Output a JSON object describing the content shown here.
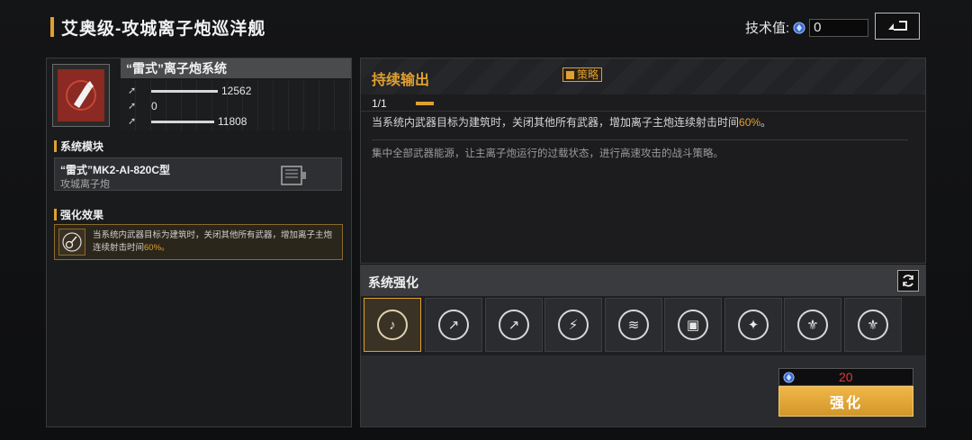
{
  "header": {
    "title": "艾奥级-攻城离子炮巡洋舰",
    "tech_label": "技术值:",
    "tech_value": "0"
  },
  "weapon": {
    "name": "“雷式”离子炮系统",
    "stats": [
      {
        "icon": "damage-icon",
        "value": "12562"
      },
      {
        "icon": "penetration-icon",
        "value": "0"
      },
      {
        "icon": "range-icon",
        "value": "11808"
      }
    ]
  },
  "module_section": {
    "label": "系统模块",
    "module_name": "“雷式”MK2-AI-820C型",
    "module_type": "攻城离子炮"
  },
  "effect_section": {
    "label": "强化效果",
    "text_main": "当系统内武器目标为建筑时，关闭其他所有武器，增加离子主炮连续射击时间",
    "text_highlight": "60%。"
  },
  "skill": {
    "title": "持续输出",
    "tag": "策略",
    "level": "1/1",
    "desc_main": "当系统内武器目标为建筑时，关闭其他所有武器，增加离子主炮连续射击时间",
    "desc_highlight": "60%",
    "desc_end": "。",
    "flavor": "集中全部武器能源，让主离子炮运行的过载状态，进行高速攻击的战斗策略。"
  },
  "enhance": {
    "title": "系统强化",
    "slots": [
      {
        "icon": "guitar-icon",
        "glyph": "♪",
        "selected": true
      },
      {
        "icon": "missile-up-icon",
        "glyph": "↗"
      },
      {
        "icon": "missile-up-alt-icon",
        "glyph": "↗"
      },
      {
        "icon": "energy-card-icon",
        "glyph": "⚡"
      },
      {
        "icon": "heat-icon",
        "glyph": "≋"
      },
      {
        "icon": "chip-icon",
        "glyph": "▣"
      },
      {
        "icon": "crest-icon",
        "glyph": "✦"
      },
      {
        "icon": "emblem-icon",
        "glyph": "⚜"
      },
      {
        "icon": "emblem-alt-icon",
        "glyph": "⚜"
      }
    ],
    "cost": "20",
    "button_label": "强化"
  },
  "colors": {
    "accent": "#e0a030",
    "cost_red": "#e03a3a",
    "weapon_red": "#8a2a22"
  }
}
